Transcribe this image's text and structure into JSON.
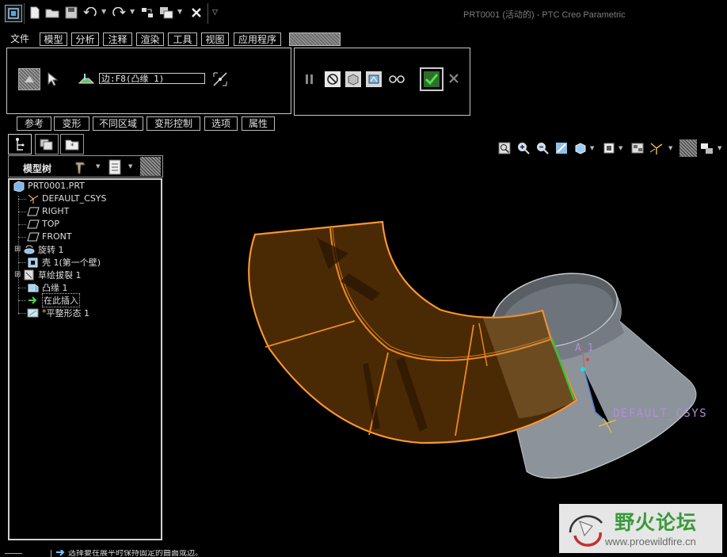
{
  "window": {
    "title": "PRT0001 (活动的) - PTC Creo Parametric"
  },
  "quick_access": {
    "icons": [
      "window-icon",
      "new-file-icon",
      "open-folder-icon",
      "save-icon",
      "undo-icon",
      "redo-icon",
      "regenerate-icon",
      "switch-windows-icon",
      "close-icon",
      "customize-dropdown-icon"
    ]
  },
  "menu": {
    "file": "文件",
    "tabs": [
      "模型",
      "分析",
      "注释",
      "渲染",
      "工具",
      "视图",
      "应用程序"
    ]
  },
  "dashboard": {
    "edge_field": "边:F8(凸缘_1)",
    "tabs": [
      "参考",
      "变形",
      "不同区域",
      "变形控制",
      "选项",
      "属性"
    ]
  },
  "navigator": {
    "title": "模型树",
    "items": [
      {
        "label": "PRT0001.PRT",
        "icon": "part-icon"
      },
      {
        "label": "DEFAULT_CSYS",
        "icon": "csys-icon"
      },
      {
        "label": "RIGHT",
        "icon": "datum-plane-icon"
      },
      {
        "label": "TOP",
        "icon": "datum-plane-icon"
      },
      {
        "label": "FRONT",
        "icon": "datum-plane-icon"
      },
      {
        "label": "旋转 1",
        "icon": "revolve-icon"
      },
      {
        "label": "壳 1(第一个壁)",
        "icon": "shell-icon"
      },
      {
        "label": "草绘拔裂 1",
        "icon": "sketch-rip-icon"
      },
      {
        "label": "凸缘 1",
        "icon": "flange-icon"
      },
      {
        "label": "在此插入",
        "icon": "insert-here-icon"
      },
      {
        "label": "平整形态 1",
        "icon": "flat-state-icon"
      }
    ]
  },
  "graphics": {
    "axis_label": "A_1",
    "csys_label": "DEFAULT_CSYS"
  },
  "status": {
    "message": "选择要在展平时保持固定的曲面或边。"
  },
  "watermark": {
    "title": "野火论坛",
    "url": "www.proewildfire.cn"
  },
  "colors": {
    "part_orange": "#f08a1e",
    "part_fill": "#4a2a05",
    "body_grey": "#8d939b",
    "csys_purple": "#b38cd8",
    "accent_green": "#34c23a"
  }
}
